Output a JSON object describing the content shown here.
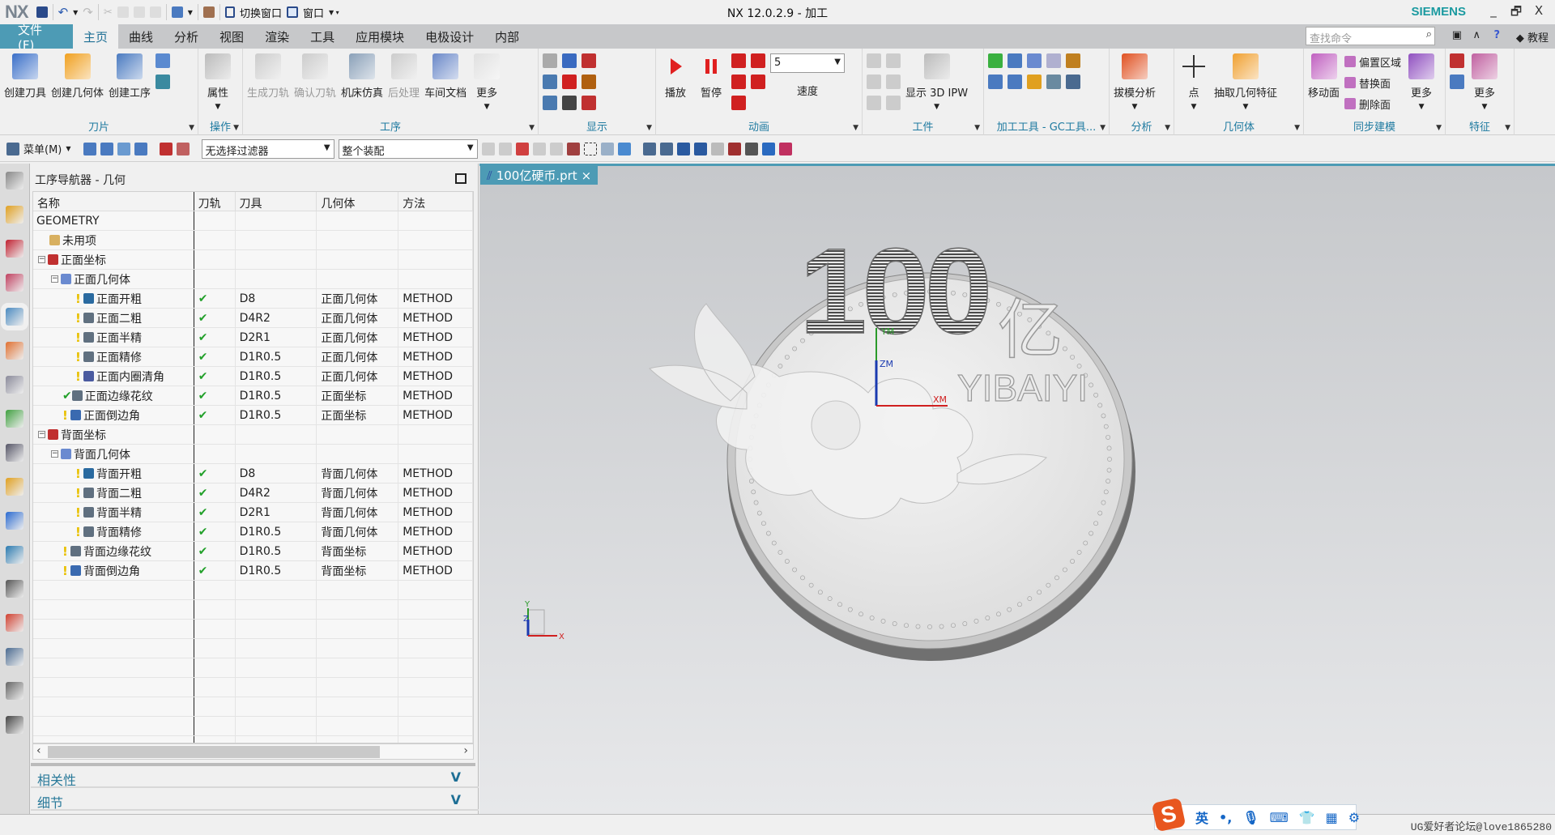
{
  "window": {
    "title": "NX 12.0.2.9 - 加工",
    "logo": "NX",
    "brand": "SIEMENS",
    "minimize": "_",
    "restore": "🗗",
    "close": "X"
  },
  "quick_access": {
    "switch_window": "切换窗口",
    "window": "窗口"
  },
  "menu": {
    "file": "文件(F)",
    "tabs": [
      "主页",
      "曲线",
      "分析",
      "视图",
      "渲染",
      "工具",
      "应用模块",
      "电极设计",
      "内部"
    ],
    "active": "主页",
    "search_placeholder": "查找命令",
    "tutorial": "教程"
  },
  "ribbon": [
    {
      "name": "刀片",
      "w": 245,
      "items": [
        {
          "type": "big",
          "label": "创建刀具",
          "icon": "create-tool-icon",
          "color": "#3a6fc8"
        },
        {
          "type": "big",
          "label": "创建几何体",
          "icon": "create-geometry-icon",
          "color": "#f0a020"
        },
        {
          "type": "big",
          "label": "创建工序",
          "icon": "create-operation-icon",
          "color": "#4a7ac0"
        },
        {
          "type": "col",
          "items": [
            {
              "icon": "create-method-icon",
              "color": "#5a8ad0"
            },
            {
              "icon": "create-program-icon",
              "color": "#3a8aa0"
            }
          ]
        }
      ]
    },
    {
      "name": "操作",
      "w": 55,
      "items": [
        {
          "type": "big",
          "label": "属性",
          "icon": "properties-icon",
          "color": "#bbbbbb",
          "dd": true
        }
      ]
    },
    {
      "name": "工序",
      "w": 365,
      "items": [
        {
          "type": "big",
          "label": "生成刀轨",
          "icon": "generate-toolpath-icon",
          "color": "#cccccc",
          "disabled": true
        },
        {
          "type": "big",
          "label": "确认刀轨",
          "icon": "verify-toolpath-icon",
          "color": "#cccccc",
          "disabled": true
        },
        {
          "type": "big",
          "label": "机床仿真",
          "icon": "machine-simulation-icon",
          "color": "#8aa0b8"
        },
        {
          "type": "big",
          "label": "后处理",
          "icon": "postprocess-icon",
          "color": "#cccccc",
          "disabled": true
        },
        {
          "type": "big",
          "label": "车间文档",
          "icon": "shop-documentation-icon",
          "color": "#6a88c8"
        },
        {
          "type": "big",
          "label": "更多",
          "icon": "more-icon",
          "color": "#e0e0e0",
          "dd": true
        }
      ]
    },
    {
      "name": "显示",
      "w": 145,
      "items": [
        {
          "type": "col",
          "items": [
            {
              "icon": "display-toolpath-icon",
              "color": "#aaaaaa"
            },
            {
              "icon": "display-2d-icon",
              "color": "#4a7ab0"
            },
            {
              "icon": "display-3d-icon",
              "color": "#4a7ab0"
            }
          ]
        },
        {
          "type": "col",
          "items": [
            {
              "icon": "layout-icon",
              "color": "#3a6ac0"
            },
            {
              "icon": "curve-icon",
              "color": "#d02020"
            },
            {
              "icon": "circle-icon",
              "color": "#444444"
            }
          ]
        },
        {
          "type": "col",
          "items": [
            {
              "icon": "point-icon",
              "color": "#c03030"
            },
            {
              "icon": "tool-holder-icon",
              "color": "#b06010"
            },
            {
              "icon": "line-icon",
              "color": "#c03030"
            }
          ]
        }
      ]
    },
    {
      "name": "动画",
      "w": 255,
      "items": [
        {
          "type": "big",
          "label": "播放",
          "icon": "play-icon",
          "color": "#e02020"
        },
        {
          "type": "big",
          "label": "暂停",
          "icon": "pause-icon",
          "color": "#e02020"
        },
        {
          "type": "col",
          "items": [
            {
              "icon": "first-frame-icon",
              "color": "#d02020"
            },
            {
              "icon": "step-back-icon",
              "color": "#d02020"
            },
            {
              "icon": "reverse-icon",
              "color": "#d02020"
            }
          ]
        },
        {
          "type": "col",
          "items": [
            {
              "icon": "last-frame-icon",
              "color": "#d02020"
            },
            {
              "icon": "step-forward-icon",
              "color": "#d02020"
            }
          ]
        },
        {
          "type": "speed",
          "value": "5",
          "label": "速度"
        }
      ]
    },
    {
      "name": "工件",
      "w": 150,
      "items": [
        {
          "type": "col",
          "items": [
            {
              "icon": "ipw-a-icon",
              "color": "#cccccc"
            },
            {
              "icon": "ipw-b-icon",
              "color": "#cccccc"
            },
            {
              "icon": "ipw-c-icon",
              "color": "#cccccc"
            }
          ]
        },
        {
          "type": "col",
          "items": [
            {
              "icon": "ipw-d-icon",
              "color": "#cccccc"
            },
            {
              "icon": "ipw-e-icon",
              "color": "#cccccc"
            },
            {
              "icon": "ipw-f-icon",
              "color": "#cccccc"
            }
          ]
        },
        {
          "type": "big",
          "label": "显示 3D IPW",
          "icon": "show-3d-ipw-icon",
          "color": "#bbbbbb",
          "dd": true
        }
      ]
    },
    {
      "name": "加工工具 - GC工具...",
      "w": 155,
      "items": [
        {
          "type": "col",
          "items": [
            {
              "icon": "check-tool-icon",
              "color": "#3ab040"
            },
            {
              "icon": "tool-list-icon",
              "color": "#4a7ac0"
            }
          ]
        },
        {
          "type": "col",
          "items": [
            {
              "icon": "tool-a-icon",
              "color": "#4a7ac0"
            },
            {
              "icon": "tool-b-icon",
              "color": "#4a7ac0"
            }
          ]
        },
        {
          "type": "col",
          "items": [
            {
              "icon": "tool-c-icon",
              "color": "#6a8ad0"
            },
            {
              "icon": "tool-d-icon",
              "color": "#e0a020"
            }
          ]
        },
        {
          "type": "col",
          "items": [
            {
              "icon": "tool-e-icon",
              "color": "#b0b0d0"
            },
            {
              "icon": "tool-f-icon",
              "color": "#6a8aa0"
            }
          ]
        },
        {
          "type": "col",
          "items": [
            {
              "icon": "tool-g-icon",
              "color": "#c08020"
            },
            {
              "icon": "tool-h-icon",
              "color": "#4a6a90"
            }
          ]
        }
      ]
    },
    {
      "name": "分析",
      "w": 80,
      "items": [
        {
          "type": "big",
          "label": "拔模分析",
          "icon": "draft-analysis-icon",
          "color": "#e05020",
          "dd": true
        }
      ]
    },
    {
      "name": "几何体",
      "w": 160,
      "items": [
        {
          "type": "big",
          "label": "点",
          "icon": "point-plus-icon",
          "color": "#f0f0f0",
          "dd": true
        },
        {
          "type": "big",
          "label": "抽取几何特征",
          "icon": "extract-geometry-icon",
          "color": "#f0a030",
          "dd": true
        }
      ]
    },
    {
      "name": "同步建模",
      "w": 175,
      "items": [
        {
          "type": "big",
          "label": "移动面",
          "icon": "move-face-icon",
          "color": "#c060c0"
        },
        {
          "type": "rows",
          "items": [
            {
              "icon": "offset-region-icon",
              "label": "偏置区域"
            },
            {
              "icon": "replace-face-icon",
              "label": "替换面"
            },
            {
              "icon": "delete-face-icon",
              "label": "删除面"
            }
          ]
        },
        {
          "type": "big",
          "label": "更多",
          "icon": "more-sync-icon",
          "color": "#9050c0",
          "dd": true
        }
      ]
    },
    {
      "name": "特征",
      "w": 85,
      "items": [
        {
          "type": "col",
          "items": [
            {
              "icon": "feature-a-icon",
              "color": "#c03030"
            },
            {
              "icon": "feature-b-icon",
              "color": "#4a7ac0"
            }
          ]
        },
        {
          "type": "big",
          "label": "更多",
          "icon": "more-feature-icon",
          "color": "#c060a0",
          "dd": true
        }
      ]
    }
  ],
  "toolbar2": {
    "menu": "菜单(M)",
    "filter": "无选择过滤器",
    "scope": "整个装配"
  },
  "navigator": {
    "title": "工序导航器 - 几何",
    "columns": [
      "名称",
      "刀轨",
      "刀具",
      "几何体",
      "方法"
    ],
    "rows": [
      {
        "level": 0,
        "name": "GEOMETRY"
      },
      {
        "level": 1,
        "name": "未用项",
        "icon": "folder-icon"
      },
      {
        "level": 1,
        "name": "正面坐标",
        "icon": "mcs-icon",
        "toggle": "−"
      },
      {
        "level": 2,
        "name": "正面几何体",
        "icon": "workpiece-icon",
        "toggle": "−"
      },
      {
        "level": 3,
        "name": "正面开粗",
        "icon": "cavity-mill-icon",
        "status": "!",
        "path": "✔",
        "tool": "D8",
        "geom": "正面几何体",
        "method": "METHOD"
      },
      {
        "level": 3,
        "name": "正面二粗",
        "icon": "contour-icon",
        "status": "!",
        "path": "✔",
        "tool": "D4R2",
        "geom": "正面几何体",
        "method": "METHOD"
      },
      {
        "level": 3,
        "name": "正面半精",
        "icon": "contour-icon",
        "status": "!",
        "path": "✔",
        "tool": "D2R1",
        "geom": "正面几何体",
        "method": "METHOD"
      },
      {
        "level": 3,
        "name": "正面精修",
        "icon": "contour-icon",
        "status": "!",
        "path": "✔",
        "tool": "D1R0.5",
        "geom": "正面几何体",
        "method": "METHOD"
      },
      {
        "level": 3,
        "name": "正面内圈清角",
        "icon": "cleanup-icon",
        "status": "!",
        "path": "✔",
        "tool": "D1R0.5",
        "geom": "正面几何体",
        "method": "METHOD"
      },
      {
        "level": 2,
        "name": "正面边缘花纹",
        "icon": "contour-icon",
        "status": "✔",
        "path": "✔",
        "tool": "D1R0.5",
        "geom": "正面坐标",
        "method": "METHOD"
      },
      {
        "level": 2,
        "name": "正面倒边角",
        "icon": "chamfer-icon",
        "status": "!",
        "path": "✔",
        "tool": "D1R0.5",
        "geom": "正面坐标",
        "method": "METHOD"
      },
      {
        "level": 1,
        "name": "背面坐标",
        "icon": "mcs-icon",
        "toggle": "−"
      },
      {
        "level": 2,
        "name": "背面几何体",
        "icon": "workpiece-icon",
        "toggle": "−"
      },
      {
        "level": 3,
        "name": "背面开粗",
        "icon": "cavity-mill-icon",
        "status": "!",
        "path": "✔",
        "tool": "D8",
        "geom": "背面几何体",
        "method": "METHOD"
      },
      {
        "level": 3,
        "name": "背面二粗",
        "icon": "contour-icon",
        "status": "!",
        "path": "✔",
        "tool": "D4R2",
        "geom": "背面几何体",
        "method": "METHOD"
      },
      {
        "level": 3,
        "name": "背面半精",
        "icon": "contour-icon",
        "status": "!",
        "path": "✔",
        "tool": "D2R1",
        "geom": "背面几何体",
        "method": "METHOD"
      },
      {
        "level": 3,
        "name": "背面精修",
        "icon": "contour-icon",
        "status": "!",
        "path": "✔",
        "tool": "D1R0.5",
        "geom": "背面几何体",
        "method": "METHOD"
      },
      {
        "level": 2,
        "name": "背面边缘花纹",
        "icon": "contour-icon",
        "status": "!",
        "path": "✔",
        "tool": "D1R0.5",
        "geom": "背面坐标",
        "method": "METHOD"
      },
      {
        "level": 2,
        "name": "背面倒边角",
        "icon": "chamfer-icon",
        "status": "!",
        "path": "✔",
        "tool": "D1R0.5",
        "geom": "背面坐标",
        "method": "METHOD"
      }
    ],
    "panels": [
      "相关性",
      "细节"
    ]
  },
  "viewport": {
    "tab": "100亿硬币.prt",
    "tab_close": "×",
    "coin": {
      "value": "100",
      "unit": "亿",
      "pinyin": "YIBAIYI",
      "xm": "XM",
      "ym": "YM",
      "zm": "ZM"
    },
    "triad": {
      "x": "X",
      "y": "Y",
      "z": "Z"
    }
  },
  "ime": {
    "logo": "S",
    "mode": "英",
    "punct": "•,"
  },
  "watermark": "UG爱好者论坛@love1865280",
  "colors": {
    "accent": "#4d9bb5",
    "brand": "#1b9aa0",
    "check": "#22a02a",
    "warn": "#e8c000"
  }
}
